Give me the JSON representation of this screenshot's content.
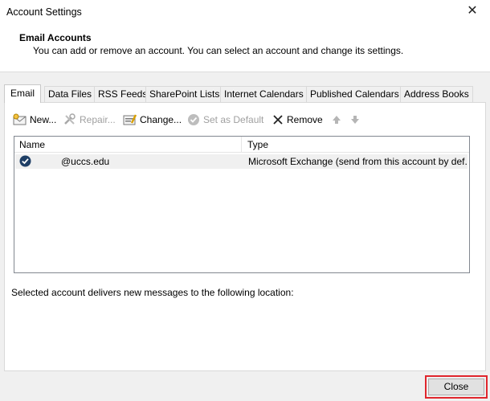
{
  "window": {
    "title": "Account Settings",
    "close_glyph": "✕"
  },
  "header": {
    "title": "Email Accounts",
    "description": "You can add or remove an account. You can select an account and change its settings."
  },
  "tabs": [
    {
      "label": "Email"
    },
    {
      "label": "Data Files"
    },
    {
      "label": "RSS Feeds"
    },
    {
      "label": "SharePoint Lists"
    },
    {
      "label": "Internet Calendars"
    },
    {
      "label": "Published Calendars"
    },
    {
      "label": "Address Books"
    }
  ],
  "toolbar": {
    "new_label": "New...",
    "repair_label": "Repair...",
    "change_label": "Change...",
    "set_default_label": "Set as Default",
    "remove_label": "Remove"
  },
  "accounts": {
    "columns": {
      "name": "Name",
      "type": "Type"
    },
    "rows": [
      {
        "name": "@uccs.edu",
        "type": "Microsoft Exchange (send from this account by def..."
      }
    ]
  },
  "delivery_text": "Selected account delivers new messages to the following location:",
  "footer": {
    "close_label": "Close"
  },
  "colors": {
    "highlight_border": "#e0262d",
    "accent": "#1f4e79"
  }
}
